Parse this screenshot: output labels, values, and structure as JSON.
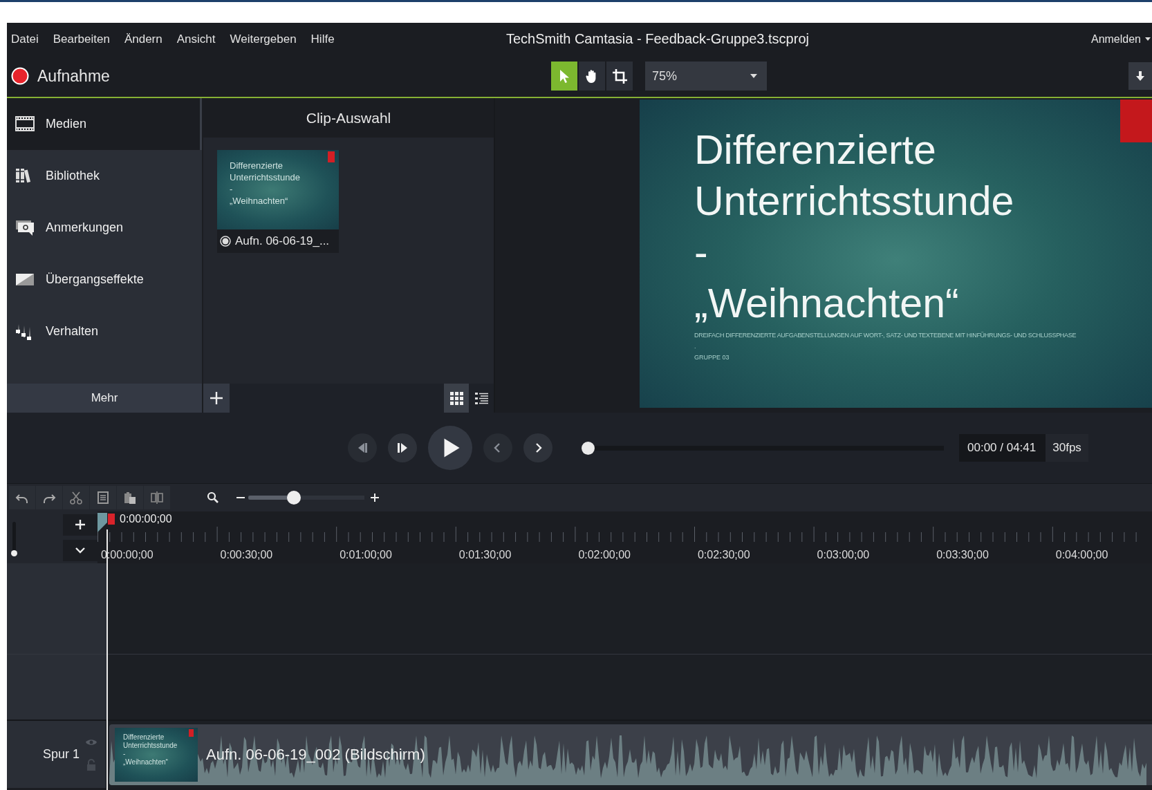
{
  "menu_bar": {
    "items": [
      "Datei",
      "Bearbeiten",
      "Ändern",
      "Ansicht",
      "Weitergeben",
      "Hilfe"
    ],
    "title": "TechSmith Camtasia - Feedback-Gruppe3.tscproj",
    "account": "Anmelden"
  },
  "toolbar": {
    "record": "Aufnahme",
    "tools": [
      {
        "kind": "select",
        "selected": true
      },
      {
        "kind": "pan",
        "selected": false
      },
      {
        "kind": "crop",
        "selected": false
      }
    ],
    "zoom": "75%"
  },
  "sidebar": {
    "items": [
      {
        "kind": "media",
        "label": "Medien",
        "selected": true
      },
      {
        "kind": "library",
        "label": "Bibliothek",
        "selected": false
      },
      {
        "kind": "annotations",
        "label": "Anmerkungen",
        "selected": false
      },
      {
        "kind": "transitions",
        "label": "Übergangseffekte",
        "selected": false
      },
      {
        "kind": "behaviors",
        "label": "Verhalten",
        "selected": false
      }
    ],
    "more": "Mehr"
  },
  "clip_bin": {
    "title": "Clip-Auswahl",
    "clips": [
      {
        "name": "Aufn. 06-06-19_...",
        "thumbnail": [
          "Differenzierte",
          "Unterrichtsstunde",
          "-",
          "„Weihnachten“"
        ]
      }
    ],
    "views": [
      {
        "kind": "grid",
        "selected": true
      },
      {
        "kind": "list",
        "selected": false
      }
    ]
  },
  "preview": {
    "title_lines": [
      "Differenzierte",
      "Unterrichtsstunde",
      "-",
      "„Weihnachten“"
    ],
    "subtitle": "DREIFACH DIFFERENZIERTE AUFGABENSTELLUNGEN AUF WORT-, SATZ- UND TEXTEBENE MIT HINFÜHRUNGS- UND SCHLUSSPHASE",
    "separator": ".",
    "group": "GRUPPE 03"
  },
  "playback": {
    "level": 0,
    "time": "00:00 / 04:41",
    "fps": "30fps"
  },
  "timeline": {
    "zoom": {
      "level": 0.39
    },
    "track_height": {
      "level": 0
    },
    "playhead": "0:00:00;00",
    "ruler": [
      "0:00:00;00",
      "0:00:30;00",
      "0:01:00;00",
      "0:01:30;00",
      "0:02:00;00",
      "0:02:30;00",
      "0:03:00;00",
      "0:03:30;00",
      "0:04:00;00"
    ],
    "tracks": [
      {
        "name": "Spur 1",
        "clip": {
          "label": "Aufn. 06-06-19_002 (Bildschirm)",
          "thumbnail": [
            "Differenzierte",
            "Unterrichtsstunde",
            "-",
            "„Weihnachten“"
          ]
        }
      }
    ]
  }
}
